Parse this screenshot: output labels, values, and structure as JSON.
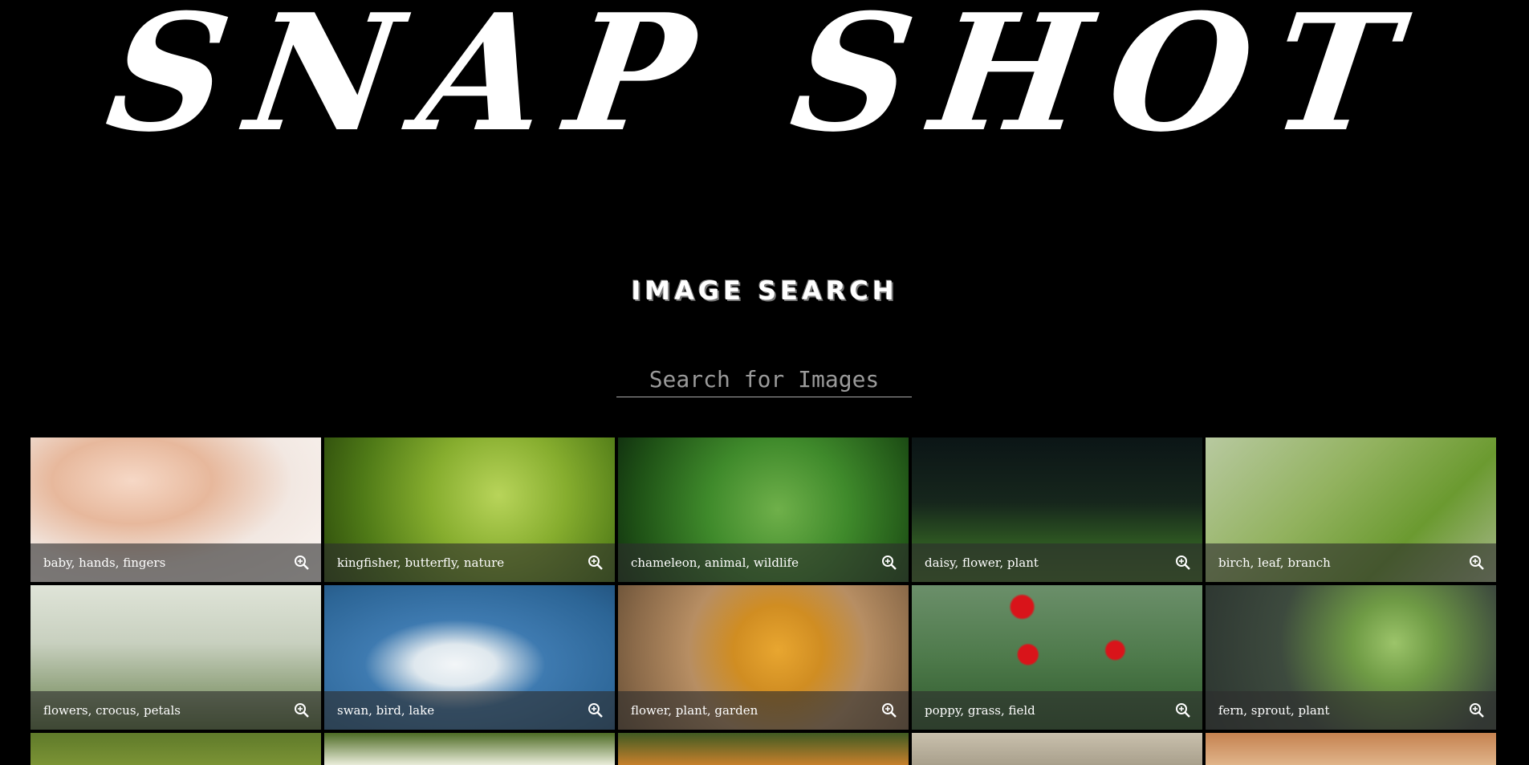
{
  "header": {
    "logo": "SNAP SHOT",
    "subtitle": "IMAGE SEARCH"
  },
  "search": {
    "placeholder": "Search for Images",
    "value": ""
  },
  "icons": {
    "tile_action": "zoom-in-icon"
  },
  "results": [
    {
      "tags": "baby, hands, fingers"
    },
    {
      "tags": "kingfisher, butterfly, nature"
    },
    {
      "tags": "chameleon, animal, wildlife"
    },
    {
      "tags": "daisy, flower, plant"
    },
    {
      "tags": "birch, leaf, branch"
    },
    {
      "tags": "flowers, crocus, petals"
    },
    {
      "tags": "swan, bird, lake"
    },
    {
      "tags": "flower, plant, garden"
    },
    {
      "tags": "poppy, grass, field"
    },
    {
      "tags": "fern, sprout, plant"
    }
  ],
  "colors": {
    "background": "#000000",
    "text": "#ffffff",
    "caption_bg": "#2d2d2d"
  }
}
